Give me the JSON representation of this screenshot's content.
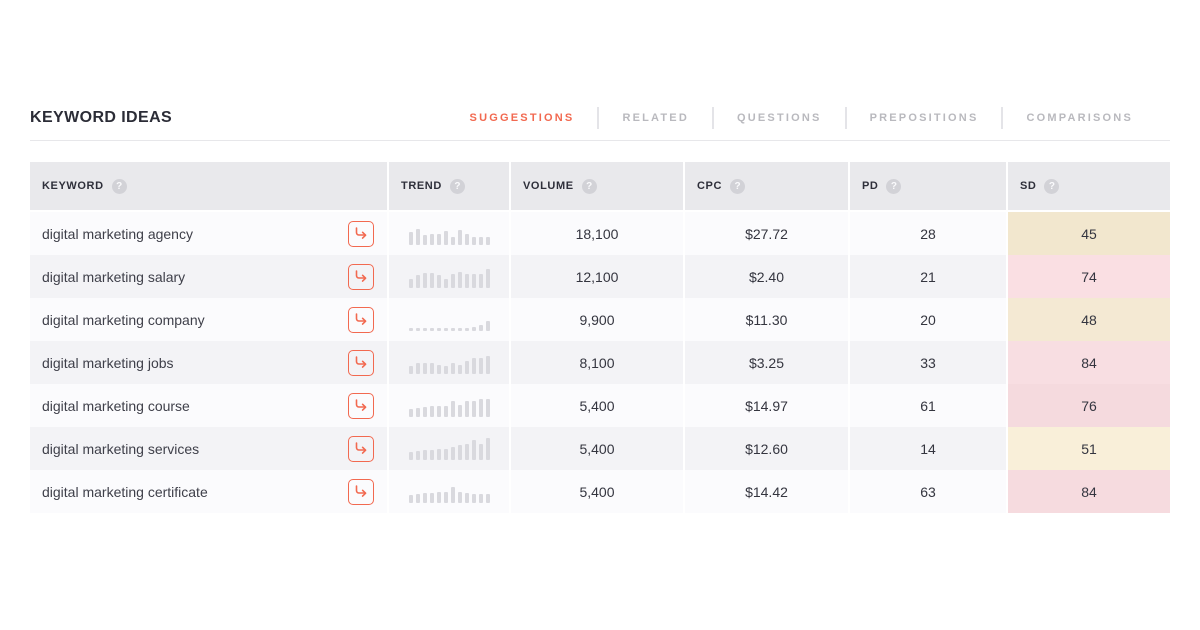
{
  "page": {
    "title": "KEYWORD IDEAS"
  },
  "colors": {
    "accent": "#f26950",
    "tab_inactive": "#b9b9be",
    "header_bg": "#e9e9ec",
    "row_odd_bg": "#fbfbfd",
    "row_even_bg": "#f3f3f6",
    "spark_bar": "#d9d9de"
  },
  "tabs": [
    {
      "label": "SUGGESTIONS",
      "active": true
    },
    {
      "label": "RELATED",
      "active": false
    },
    {
      "label": "QUESTIONS",
      "active": false
    },
    {
      "label": "PREPOSITIONS",
      "active": false
    },
    {
      "label": "COMPARISONS",
      "active": false
    }
  ],
  "table": {
    "help_icon": "?",
    "columns": [
      {
        "key": "keyword",
        "label": "KEYWORD"
      },
      {
        "key": "trend",
        "label": "TREND"
      },
      {
        "key": "volume",
        "label": "VOLUME"
      },
      {
        "key": "cpc",
        "label": "CPC"
      },
      {
        "key": "pd",
        "label": "PD"
      },
      {
        "key": "sd",
        "label": "SD"
      }
    ],
    "rows": [
      {
        "keyword": "digital marketing agency",
        "trend": [
          13,
          16,
          10,
          11,
          11,
          14,
          8,
          15,
          11,
          8,
          8,
          8
        ],
        "volume": "18,100",
        "cpc": "$27.72",
        "pd": "28",
        "sd": "45",
        "sd_bg": "#f2e7ce"
      },
      {
        "keyword": "digital marketing salary",
        "trend": [
          9,
          13,
          15,
          15,
          13,
          9,
          14,
          16,
          14,
          14,
          14,
          19
        ],
        "volume": "12,100",
        "cpc": "$2.40",
        "pd": "21",
        "sd": "74",
        "sd_bg": "#fadfe3"
      },
      {
        "keyword": "digital marketing company",
        "trend": [
          3,
          3,
          3,
          3,
          3,
          3,
          3,
          3,
          3,
          4,
          6,
          10
        ],
        "volume": "9,900",
        "cpc": "$11.30",
        "pd": "20",
        "sd": "48",
        "sd_bg": "#f4e9d3"
      },
      {
        "keyword": "digital marketing jobs",
        "trend": [
          8,
          11,
          11,
          11,
          9,
          8,
          11,
          9,
          13,
          16,
          16,
          18
        ],
        "volume": "8,100",
        "cpc": "$3.25",
        "pd": "33",
        "sd": "84",
        "sd_bg": "#f8dee2"
      },
      {
        "keyword": "digital marketing course",
        "trend": [
          8,
          9,
          10,
          11,
          11,
          11,
          16,
          12,
          16,
          16,
          18,
          18
        ],
        "volume": "5,400",
        "cpc": "$14.97",
        "pd": "61",
        "sd": "76",
        "sd_bg": "#f5dade"
      },
      {
        "keyword": "digital marketing services",
        "trend": [
          8,
          9,
          10,
          10,
          11,
          11,
          13,
          15,
          16,
          20,
          16,
          22
        ],
        "volume": "5,400",
        "cpc": "$12.60",
        "pd": "14",
        "sd": "51",
        "sd_bg": "#f9efd9"
      },
      {
        "keyword": "digital marketing certificate",
        "trend": [
          8,
          9,
          10,
          10,
          11,
          11,
          16,
          11,
          10,
          9,
          9,
          9
        ],
        "volume": "5,400",
        "cpc": "$14.42",
        "pd": "63",
        "sd": "84",
        "sd_bg": "#f6dbdf"
      }
    ]
  }
}
